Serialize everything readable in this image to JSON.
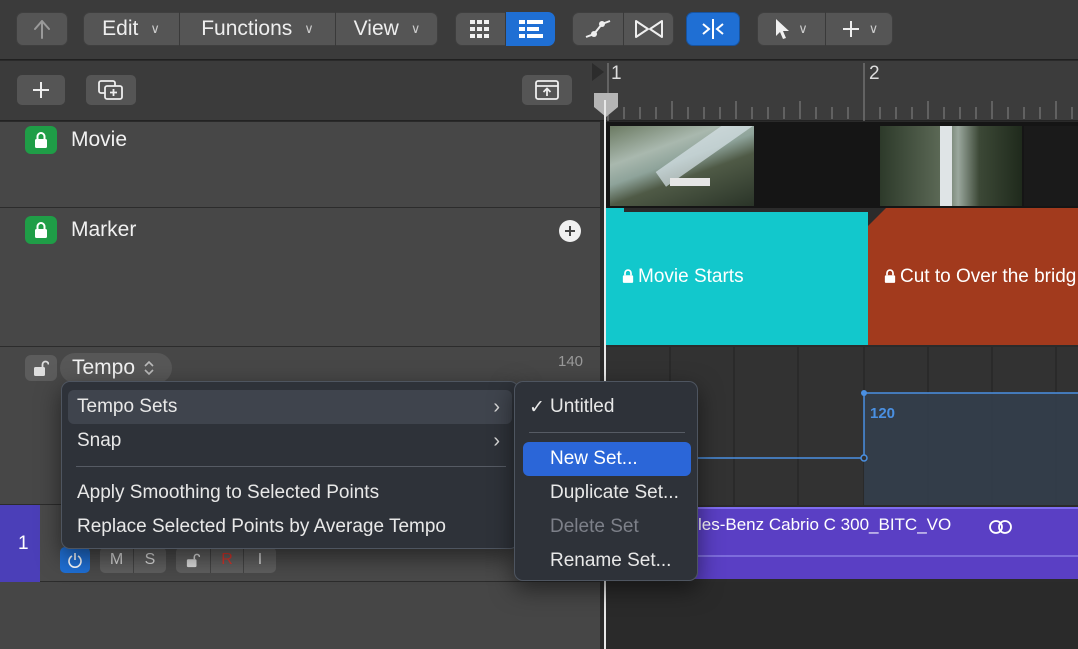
{
  "toolbar": {
    "back_icon": "arrow-up-icon",
    "edit_label": "Edit",
    "functions_label": "Functions",
    "view_label": "View",
    "chevron": "⌄"
  },
  "ruler": {
    "bar1": "1",
    "bar2": "2"
  },
  "tracks": {
    "movie": {
      "name": "Movie"
    },
    "marker": {
      "name": "Marker"
    },
    "tempo": {
      "name": "Tempo",
      "value_top": "140",
      "curve_value": "120"
    },
    "audio": {
      "number": "1",
      "region_name": "les-Benz Cabrio C 300_BITC_VO",
      "buttons": {
        "mute": "M",
        "solo": "S",
        "record": "R",
        "input": "I"
      }
    }
  },
  "markers": [
    {
      "label": "Movie Starts",
      "color": "#12c8cc"
    },
    {
      "label": "Cut to Over the bridg",
      "color": "#a23a1d"
    }
  ],
  "context_menu": {
    "items": [
      {
        "label": "Tempo Sets",
        "submenu": true
      },
      {
        "label": "Snap",
        "submenu": true
      },
      {
        "label": "Apply Smoothing to Selected Points"
      },
      {
        "label": "Replace Selected Points by Average Tempo"
      }
    ]
  },
  "submenu": {
    "checkmark": "✓",
    "items": [
      {
        "label": "Untitled",
        "checked": true
      },
      {
        "label": "New Set..."
      },
      {
        "label": "Duplicate Set..."
      },
      {
        "label": "Delete Set",
        "disabled": true
      },
      {
        "label": "Rename Set..."
      }
    ]
  },
  "colors": {
    "accent": "#1f6fd4",
    "lock_green": "#1f9d47",
    "marker_cyan": "#12c8cc",
    "marker_red": "#a23a1d",
    "audio_region": "#5a3fc4",
    "menu_selection": "#2b66d8"
  }
}
